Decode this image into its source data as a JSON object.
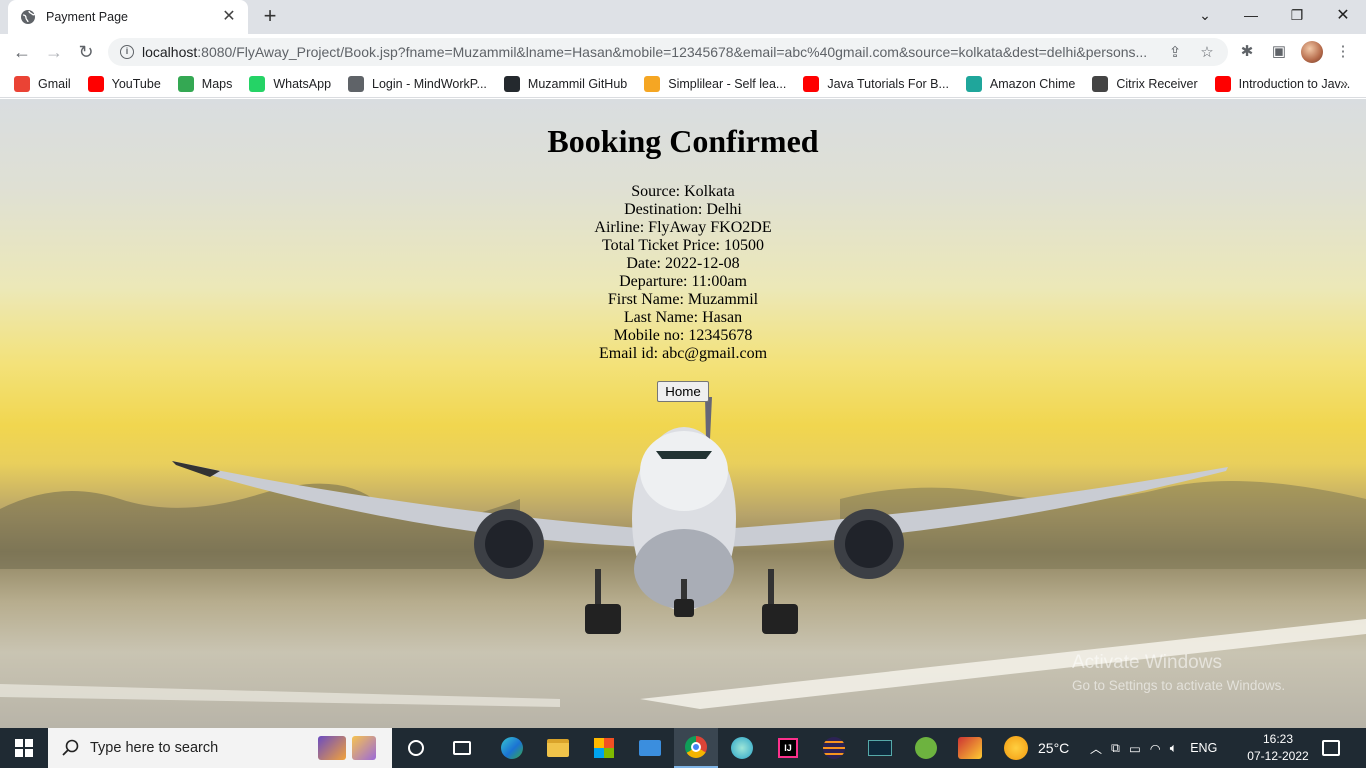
{
  "browser": {
    "tab_title": "Payment Page",
    "url_host": "localhost",
    "url_rest": ":8080/FlyAway_Project/Book.jsp?fname=Muzammil&lname=Hasan&mobile=12345678&email=abc%40gmail.com&source=kolkata&dest=delhi&persons...",
    "bookmarks": [
      {
        "label": "Gmail",
        "icon": "gmail-icon",
        "color": "#ea4335"
      },
      {
        "label": "YouTube",
        "icon": "youtube-icon",
        "color": "#ff0000"
      },
      {
        "label": "Maps",
        "icon": "maps-icon",
        "color": "#34a853"
      },
      {
        "label": "WhatsApp",
        "icon": "whatsapp-icon",
        "color": "#25d366"
      },
      {
        "label": "Login - MindWorkP...",
        "icon": "globe-icon",
        "color": "#5f6368"
      },
      {
        "label": "Muzammil GitHub",
        "icon": "github-icon",
        "color": "#24292e"
      },
      {
        "label": "Simplilear - Self lea...",
        "icon": "simplilearn-icon",
        "color": "#f5a623"
      },
      {
        "label": "Java Tutorials For B...",
        "icon": "youtube-icon",
        "color": "#ff0000"
      },
      {
        "label": "Amazon Chime",
        "icon": "chime-icon",
        "color": "#1fa69b"
      },
      {
        "label": "Citrix Receiver",
        "icon": "citrix-icon",
        "color": "#444444"
      },
      {
        "label": "Introduction to Jav...",
        "icon": "youtube-icon",
        "color": "#ff0000"
      }
    ]
  },
  "page": {
    "heading": "Booking Confirmed",
    "details": [
      "Source: Kolkata",
      "Destination: Delhi",
      "Airline: FlyAway FKO2DE",
      "Total Ticket Price: 10500",
      "Date: 2022-12-08",
      "Departure: 11:00am",
      "First Name: Muzammil",
      "Last Name: Hasan",
      "Mobile no: 12345678",
      "Email id: abc@gmail.com"
    ],
    "home_button": "Home",
    "watermark_title": "Activate Windows",
    "watermark_sub": "Go to Settings to activate Windows."
  },
  "taskbar": {
    "search_placeholder": "Type here to search",
    "weather": "25°C",
    "language": "ENG",
    "time": "16:23",
    "date": "07-12-2022"
  }
}
